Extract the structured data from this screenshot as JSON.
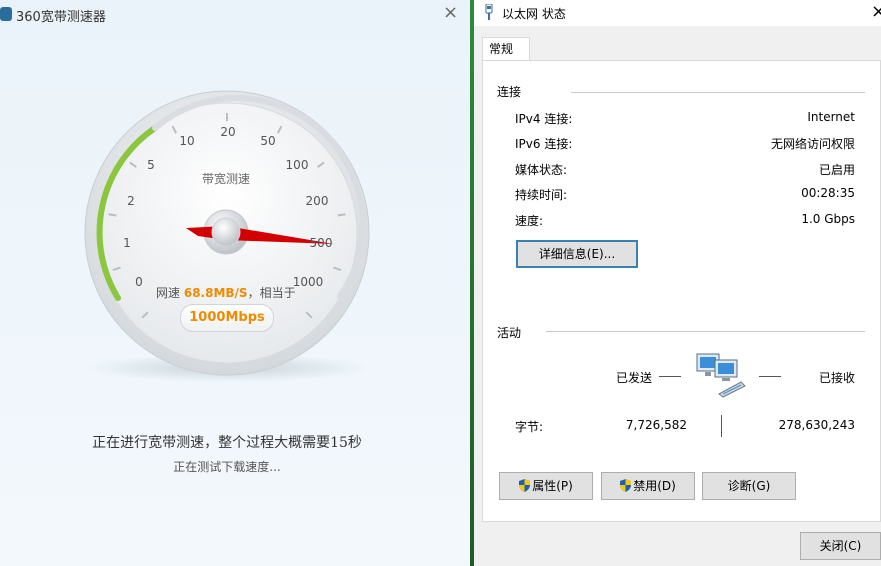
{
  "speedtest": {
    "title": "360宽带测速器",
    "close": "×",
    "gauge": {
      "label": "带宽测速",
      "ticks": [
        "0",
        "1",
        "2",
        "5",
        "10",
        "20",
        "50",
        "100",
        "200",
        "500",
        "1000"
      ],
      "needle_value": "500"
    },
    "speed_prefix": "网速",
    "speed_value": "68.8MB/S",
    "speed_suffix": "，相当于",
    "mbps": "1000Mbps",
    "status": "正在进行宽带测速，整个过程大概需要15秒",
    "substatus": "正在测试下载速度..."
  },
  "ethernet": {
    "title": "以太网 状态",
    "close": "×",
    "tab": "常规",
    "connection": {
      "header": "连接",
      "rows": [
        {
          "label": "IPv4 连接:",
          "value": "Internet"
        },
        {
          "label": "IPv6 连接:",
          "value": "无网络访问权限"
        },
        {
          "label": "媒体状态:",
          "value": "已启用"
        },
        {
          "label": "持续时间:",
          "value": "00:28:35"
        },
        {
          "label": "速度:",
          "value": "1.0 Gbps"
        }
      ],
      "details_button": "详细信息(E)..."
    },
    "activity": {
      "header": "活动",
      "sent_label": "已发送",
      "received_label": "已接收",
      "bytes_label": "字节:",
      "sent_bytes": "7,726,582",
      "received_bytes": "278,630,243"
    },
    "buttons": {
      "properties": "属性(P)",
      "disable": "禁用(D)",
      "diagnose": "诊断(G)",
      "close": "关闭(C)"
    }
  },
  "icons": [
    "speedtest-logo-icon",
    "close-icon",
    "network-adapter-icon",
    "shield-icon",
    "network-computers-icon"
  ],
  "colors": {
    "speed_orange": "#f08a00",
    "needle_red": "#d40000",
    "gauge_green": "#8cc63f",
    "focus_blue": "#3c7fb1"
  }
}
